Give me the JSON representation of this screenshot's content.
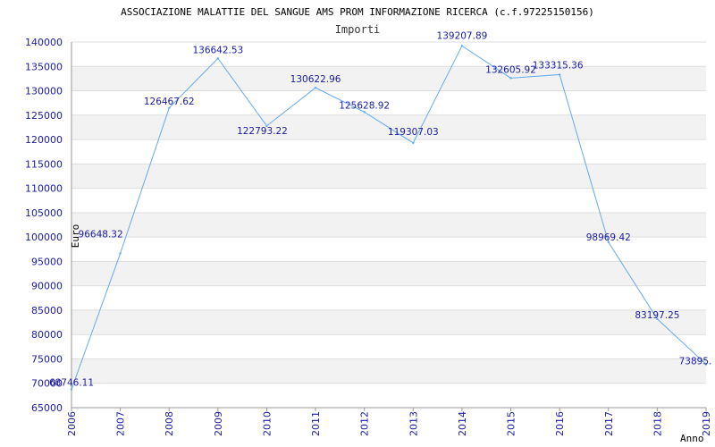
{
  "chart_data": {
    "type": "line",
    "title": "ASSOCIAZIONE MALATTIE DEL SANGUE AMS PROM INFORMAZIONE RICERCA (c.f.97225150156)",
    "subtitle": "Importi",
    "xlabel": "Anno",
    "ylabel": "Euro",
    "categories": [
      "2006",
      "2007",
      "2008",
      "2009",
      "2010",
      "2011",
      "2012",
      "2013",
      "2014",
      "2015",
      "2016",
      "2017",
      "2018",
      "2019"
    ],
    "series": [
      {
        "values": [
          68746.11,
          96648.32,
          126467.62,
          136642.53,
          122793.22,
          130622.96,
          125628.92,
          119307.03,
          139207.89,
          132605.92,
          133315.36,
          98969.42,
          83197.25,
          73895.0
        ],
        "labels": [
          "68746.11",
          "96648.32",
          "126467.62",
          "136642.53",
          "122793.22",
          "130622.96",
          "125628.92",
          "119307.03",
          "139207.89",
          "132605.92",
          "133315.36",
          "98969.42",
          "83197.25",
          "73895."
        ],
        "color": "#66aaee"
      }
    ],
    "ylim": [
      65000,
      140000
    ],
    "yticks": [
      "65000",
      "70000",
      "75000",
      "80000",
      "85000",
      "90000",
      "95000",
      "100000",
      "105000",
      "110000",
      "115000",
      "120000",
      "125000",
      "130000",
      "135000",
      "140000"
    ],
    "grid": true,
    "band_color": "#f2f2f2",
    "axis_label_color": "#1a1aa6"
  }
}
